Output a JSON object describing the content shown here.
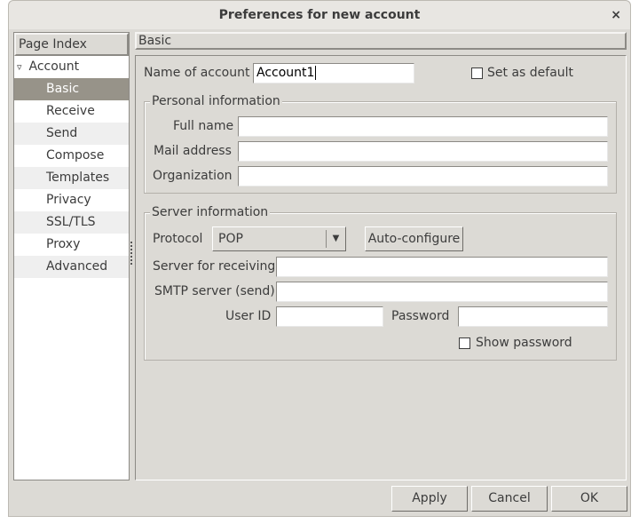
{
  "window": {
    "title": "Preferences for new account",
    "close_glyph": "×"
  },
  "index": {
    "header": "Page Index",
    "account": "Account",
    "expander_glyph": "▿",
    "items": [
      "Basic",
      "Receive",
      "Send",
      "Compose",
      "Templates",
      "Privacy",
      "SSL/TLS",
      "Proxy",
      "Advanced"
    ],
    "selected": "Basic"
  },
  "page": {
    "header": "Basic",
    "name_label": "Name of account",
    "name_value": "Account1",
    "default_label": "Set as default",
    "default_checked": false,
    "personal": {
      "legend": "Personal information",
      "full_name": "Full name",
      "mail": "Mail address",
      "org": "Organization"
    },
    "server": {
      "legend": "Server information",
      "protocol_label": "Protocol",
      "protocol_value": "POP",
      "autoconf": "Auto-configure",
      "receive": "Server for receiving",
      "smtp": "SMTP server (send)",
      "userid": "User ID",
      "password": "Password",
      "show_password": "Show password",
      "show_password_checked": false
    }
  },
  "buttons": {
    "apply": "Apply",
    "cancel": "Cancel",
    "ok": "OK"
  }
}
